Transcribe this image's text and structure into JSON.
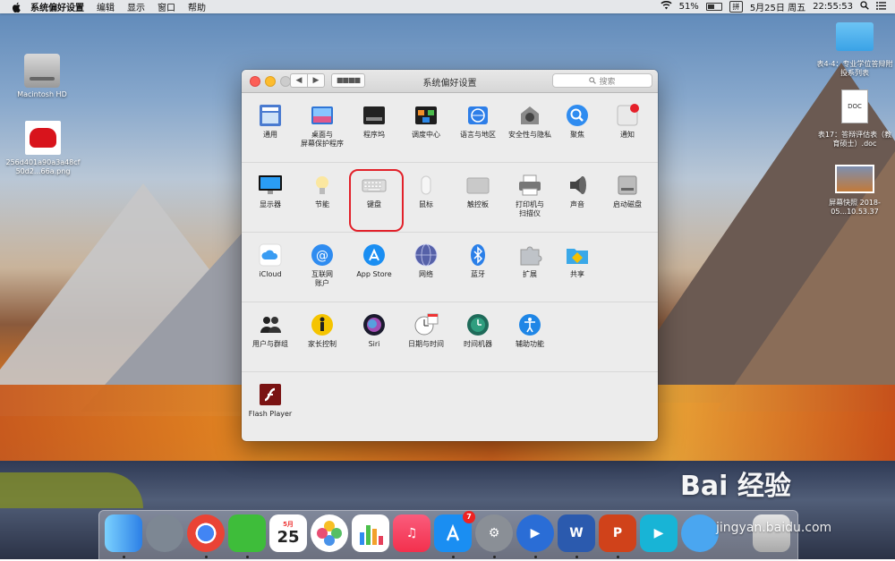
{
  "menubar": {
    "app": "系统偏好设置",
    "menus": [
      "编辑",
      "显示",
      "窗口",
      "帮助"
    ],
    "battery": "51%",
    "ime": "拼",
    "date": "5月25日 周五",
    "time": "22:55:53"
  },
  "desktop": {
    "left_icons": [
      {
        "label": "Macintosh HD",
        "icon": "hard-disk-icon"
      },
      {
        "label": "256d401a90a3a48cf50d2...66a.png",
        "icon": "image-file-icon"
      }
    ],
    "right_icons": [
      {
        "label": "表4-4：专业学位答辩附投系列表",
        "icon": "folder-icon"
      },
      {
        "label": "表17：答辩评估表（教育硕士）.doc",
        "icon": "doc-file-icon"
      },
      {
        "label": "屏幕快照 2018-05...10.53.37",
        "icon": "screenshot-file-icon"
      }
    ]
  },
  "window": {
    "title": "系统偏好设置",
    "search_placeholder": "搜索",
    "rows": [
      [
        {
          "label": "通用",
          "icon": "general-icon"
        },
        {
          "label": "桌面与\n屏幕保护程序",
          "icon": "desktop-screensaver-icon"
        },
        {
          "label": "程序坞",
          "icon": "dock-icon"
        },
        {
          "label": "调度中心",
          "icon": "mission-control-icon"
        },
        {
          "label": "语言与地区",
          "icon": "language-region-icon"
        },
        {
          "label": "安全性与隐私",
          "icon": "security-privacy-icon"
        },
        {
          "label": "聚焦",
          "icon": "spotlight-icon"
        },
        {
          "label": "通知",
          "icon": "notifications-icon"
        }
      ],
      [
        {
          "label": "显示器",
          "icon": "displays-icon"
        },
        {
          "label": "节能",
          "icon": "energy-saver-icon"
        },
        {
          "label": "键盘",
          "icon": "keyboard-icon"
        },
        {
          "label": "鼠标",
          "icon": "mouse-icon"
        },
        {
          "label": "触控板",
          "icon": "trackpad-icon"
        },
        {
          "label": "打印机与\n扫描仪",
          "icon": "printers-scanners-icon"
        },
        {
          "label": "声音",
          "icon": "sound-icon"
        },
        {
          "label": "启动磁盘",
          "icon": "startup-disk-icon"
        }
      ],
      [
        {
          "label": "iCloud",
          "icon": "icloud-icon"
        },
        {
          "label": "互联网\n账户",
          "icon": "internet-accounts-icon"
        },
        {
          "label": "App Store",
          "icon": "app-store-icon"
        },
        {
          "label": "网络",
          "icon": "network-icon"
        },
        {
          "label": "蓝牙",
          "icon": "bluetooth-icon"
        },
        {
          "label": "扩展",
          "icon": "extensions-icon"
        },
        {
          "label": "共享",
          "icon": "sharing-icon"
        }
      ],
      [
        {
          "label": "用户与群组",
          "icon": "users-groups-icon"
        },
        {
          "label": "家长控制",
          "icon": "parental-controls-icon"
        },
        {
          "label": "Siri",
          "icon": "siri-icon"
        },
        {
          "label": "日期与时间",
          "icon": "date-time-icon"
        },
        {
          "label": "时间机器",
          "icon": "time-machine-icon"
        },
        {
          "label": "辅助功能",
          "icon": "accessibility-icon"
        }
      ],
      [
        {
          "label": "Flash Player",
          "icon": "flash-player-icon"
        }
      ]
    ]
  },
  "dock": {
    "calendar_month": "5月",
    "calendar_day": "25",
    "app_store_badge": "7"
  },
  "watermark": {
    "text": "Bai 经验",
    "sub": "jingyan.baidu.com"
  }
}
